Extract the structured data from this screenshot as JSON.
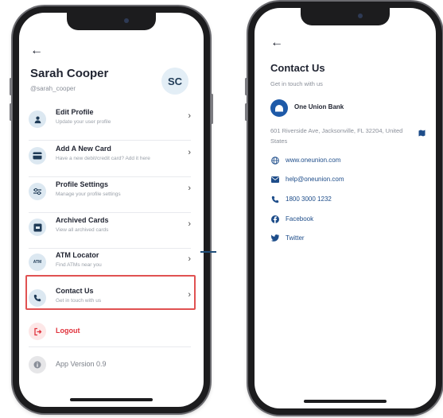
{
  "profile_screen": {
    "name": "Sarah Cooper",
    "handle": "@sarah_cooper",
    "avatar_initials": "SC",
    "menu": [
      {
        "title": "Edit Profile",
        "subtitle": "Update your user profile",
        "icon": "user-icon"
      },
      {
        "title": "Add A New Card",
        "subtitle": "Have a new debit/credit card? Add it here",
        "icon": "card-icon"
      },
      {
        "title": "Profile Settings",
        "subtitle": "Manage your profile settings",
        "icon": "sliders-icon"
      },
      {
        "title": "Archived Cards",
        "subtitle": "View all archived cards",
        "icon": "archive-icon"
      },
      {
        "title": "ATM Locator",
        "subtitle": "Find ATMs near you",
        "icon": "atm-icon",
        "icon_text": "ATM"
      },
      {
        "title": "Contact Us",
        "subtitle": "Get in touch with us",
        "icon": "phone-icon"
      }
    ],
    "logout_label": "Logout",
    "version_label": "App Version 0.9",
    "highlight_color": "#e05252"
  },
  "contact_screen": {
    "title": "Contact Us",
    "subtitle": "Get in touch with us",
    "bank_name": "One Union Bank",
    "address": "601 Riverside Ave, Jacksonville, FL 32204, United States",
    "contacts": [
      {
        "text": "www.oneunion.com",
        "icon": "globe-icon"
      },
      {
        "text": "help@oneunion.com",
        "icon": "mail-icon"
      },
      {
        "text": "1800 3000 1232",
        "icon": "phone-icon"
      },
      {
        "text": "Facebook",
        "icon": "facebook-icon"
      },
      {
        "text": "Twitter",
        "icon": "twitter-icon"
      }
    ],
    "link_color": "#1e4d8a",
    "brand_color": "#1e5aa8"
  }
}
